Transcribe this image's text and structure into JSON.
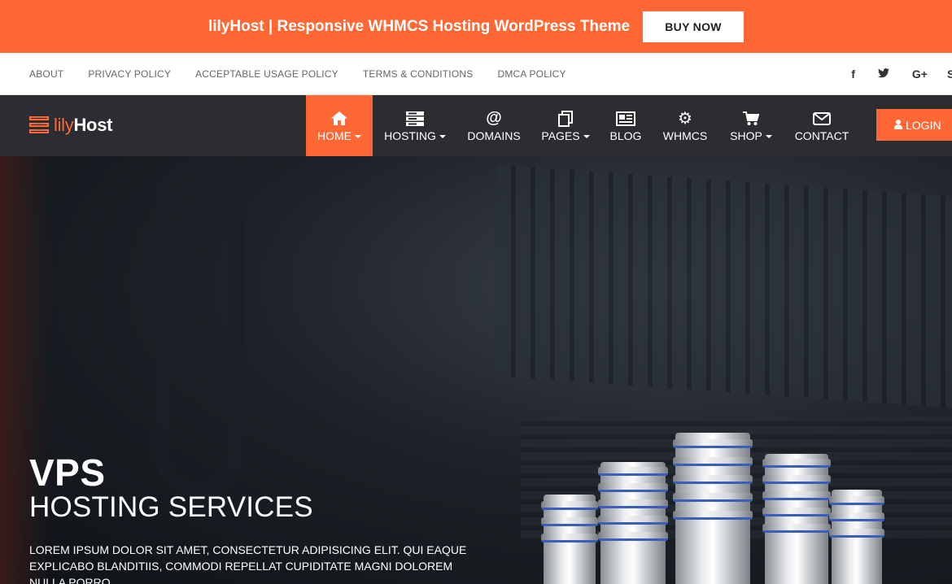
{
  "promo": {
    "text": "lilyHost | Responsive WHMCS Hosting WordPress Theme",
    "button": "BUY NOW"
  },
  "toplinks": [
    "ABOUT",
    "PRIVACY POLICY",
    "ACCEPTABLE USAGE POLICY",
    "TERMS & CONDITIONS",
    "DMCA POLICY"
  ],
  "social": {
    "facebook": "f",
    "twitter": "t",
    "google": "G+",
    "more": "S"
  },
  "logo": {
    "part1": "lily",
    "part2": "Host"
  },
  "menu": [
    {
      "label": "HOME",
      "icon": "home-icon",
      "caret": true,
      "active": true
    },
    {
      "label": "HOSTING",
      "icon": "server-icon",
      "caret": true,
      "active": false
    },
    {
      "label": "DOMAINS",
      "icon": "at-icon",
      "caret": false,
      "active": false
    },
    {
      "label": "PAGES",
      "icon": "pages-icon",
      "caret": true,
      "active": false
    },
    {
      "label": "BLOG",
      "icon": "newspaper-icon",
      "caret": false,
      "active": false
    },
    {
      "label": "WHMCS",
      "icon": "gear-icon",
      "caret": false,
      "active": false
    },
    {
      "label": "SHOP",
      "icon": "cart-icon",
      "caret": true,
      "active": false
    },
    {
      "label": "CONTACT",
      "icon": "envelope-icon",
      "caret": false,
      "active": false
    }
  ],
  "login": "LOGIN",
  "hero": {
    "title1": "VPS",
    "title2": "HOSTING SERVICES",
    "desc": "LOREM IPSUM DOLOR SIT AMET, CONSECTETUR ADIPISICING ELIT. QUI EAQUE EXPLICABO BLANDITIIS, COMMODI REPELLAT CUPIDITATE MAGNI DOLOREM NULLA PORRO"
  },
  "colors": {
    "accent": "#ff6835",
    "nav": "#2c2d31"
  }
}
